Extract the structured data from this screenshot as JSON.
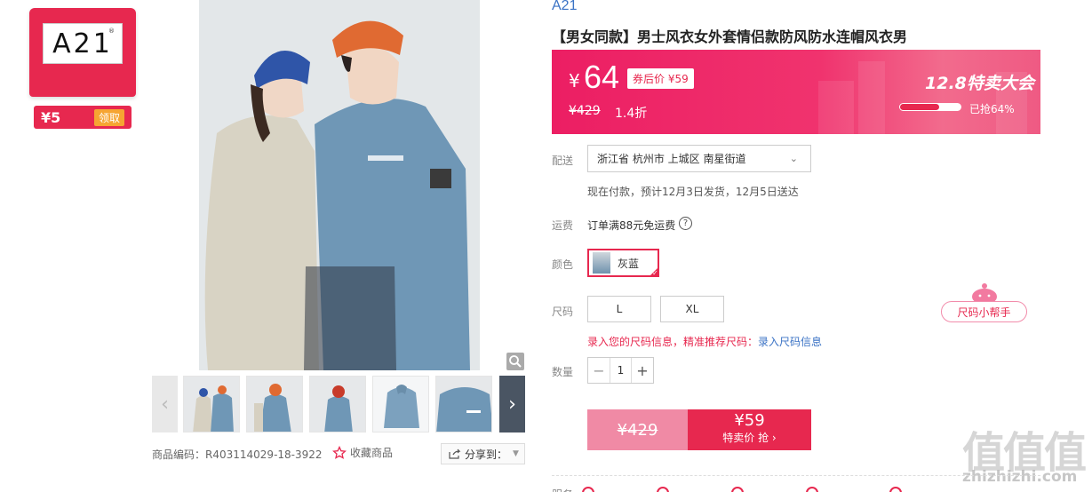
{
  "brand_card": {
    "logo_text": "A21",
    "logo_mark": "®",
    "coupon_amount": "¥5",
    "coupon_button": "领取"
  },
  "gallery": {
    "thumbnail_count": 5,
    "prev_icon": "chevron-left-icon",
    "next_icon": "chevron-right-icon",
    "zoom_icon": "magnifier-icon"
  },
  "product_meta": {
    "code_label": "商品编码：",
    "code_value": "R403114029-18-3922",
    "favorite_label": "收藏商品",
    "share_label": "分享到："
  },
  "product": {
    "brand": "A21",
    "title": "【男女同款】男士风衣女外套情侣款防风防水连帽风衣男"
  },
  "price": {
    "currency": "¥",
    "current": "64",
    "coupon_price": "券后价 ¥59",
    "original": "¥429",
    "discount": "1.4折",
    "promo_title": "12.8特卖大会",
    "sold_percent": 64,
    "sold_text": "已抢64%"
  },
  "delivery": {
    "label": "配送",
    "address": "浙江省 杭州市 上城区 南星街道",
    "note": "现在付款，预计12月3日发货，12月5日送达"
  },
  "shipping": {
    "label": "运费",
    "text": "订单满88元免运费",
    "help_icon": "?"
  },
  "color": {
    "label": "颜色",
    "selected": "灰蓝"
  },
  "size": {
    "label": "尺码",
    "options": [
      "L",
      "XL"
    ],
    "helper": "尺码小帮手",
    "tip": "录入您的尺码信息，精准推荐尺码：",
    "tip_link": "录入尺码信息"
  },
  "quantity": {
    "label": "数量",
    "minus": "−",
    "value": "1",
    "plus": "+"
  },
  "buy": {
    "original": "¥429",
    "price": "¥59",
    "label": "特卖价 抢 ›"
  },
  "watermark": {
    "big": "值值值",
    "small": "zhizhizhi.com"
  },
  "bottom": {
    "label": "服务"
  },
  "colors": {
    "accent": "#e7284f",
    "link": "#3b73c5"
  }
}
